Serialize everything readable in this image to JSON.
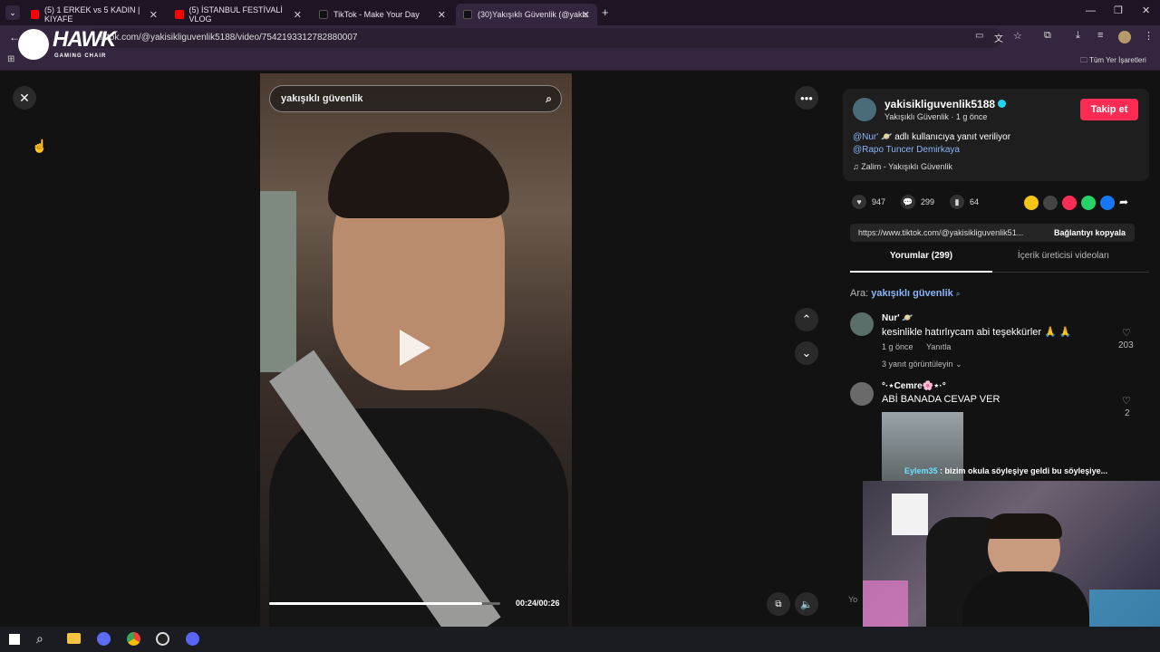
{
  "tabs": [
    {
      "label": "(5) 1 ERKEK vs 5 KADIN | KIYAFE",
      "icon": "youtube-icon"
    },
    {
      "label": "(5) İSTANBUL FESTİVALİ VLOG",
      "icon": "youtube-icon"
    },
    {
      "label": "TikTok - Make Your Day",
      "icon": "tiktok-icon"
    },
    {
      "label": "(30)Yakışıklı Güvenlik (@yakisikl",
      "icon": "tiktok-icon"
    }
  ],
  "address": {
    "url": "tiktok.com/@yakisikliguvenlik5188/video/7542193312782880007"
  },
  "bookmarks": {
    "all_label": "Tüm Yer İşaretleri"
  },
  "logo": {
    "name": "HAWK",
    "sub": "GAMING CHAIR"
  },
  "video": {
    "search_text": "yakışıklı güvenlik",
    "time": "00:24/00:26",
    "progress": 0.92
  },
  "profile": {
    "username": "yakisikliguvenlik5188",
    "display": "Yakışıklı Güvenlik · 1 g önce",
    "follow_label": "Takip et",
    "reply_mention": "@Nur' 🪐",
    "reply_text": "adlı kullanıcıya yanıt veriliyor",
    "mention2": "@Rapo Tuncer Demirkaya",
    "music": "Zalim - Yakışıklı Güvenlik"
  },
  "stats": {
    "likes": "947",
    "comments": "299",
    "saves": "64"
  },
  "share": {
    "url": "https://www.tiktok.com/@yakisikliguvenlik51...",
    "copy_label": "Bağlantıyı kopyala"
  },
  "panel_tabs": {
    "comments": "Yorumlar (299)",
    "creator": "İçerik üreticisi videoları"
  },
  "search": {
    "prefix": "Ara:",
    "query": "yakışıklı güvenlik"
  },
  "comments": [
    {
      "name": "Nur' 🪐",
      "text": "kesinlikle hatırlıycam abi teşekkürler 🙏 🙏",
      "time": "1 g önce",
      "reply": "Yanıtla",
      "likes": "203",
      "more": "3 yanıt görüntüleyin"
    },
    {
      "name": "°·⋆Cemre🌸⋆·°",
      "text": "ABİ BANADA CEVAP VER",
      "likes": "2"
    }
  ],
  "overlay_chat": {
    "user": "Eylem35",
    "text": ": bizim okula söyleşiye geldi bu söyleşiye..."
  },
  "input_placeholder": "Yo"
}
